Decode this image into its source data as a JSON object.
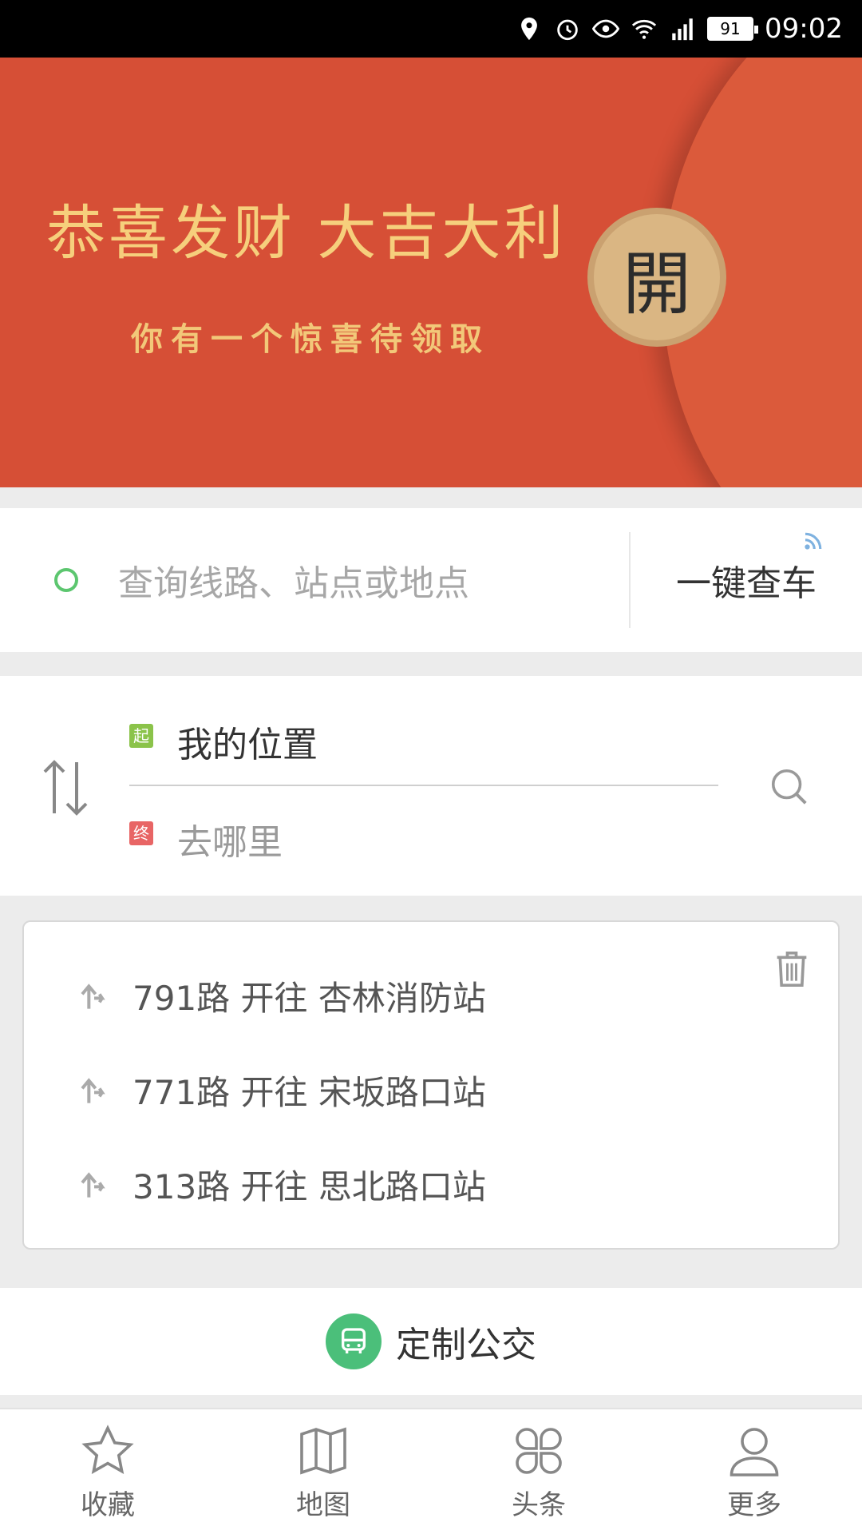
{
  "status": {
    "time": "09:02",
    "battery": "91",
    "network": "4G"
  },
  "banner": {
    "title": "恭喜发财 大吉大利",
    "subtitle": "你有一个惊喜待领取",
    "coin": "開"
  },
  "search": {
    "placeholder": "查询线路、站点或地点",
    "quick_check": "一键查车"
  },
  "route": {
    "start_tag": "起",
    "end_tag": "终",
    "from": "我的位置",
    "to_placeholder": "去哪里"
  },
  "history": {
    "items": [
      {
        "route": "791路 开往 杏林消防站"
      },
      {
        "route": "771路 开往 宋坂路口站"
      },
      {
        "route": "313路 开往 思北路口站"
      }
    ]
  },
  "custom_bus": {
    "label": "定制公交"
  },
  "tabs": [
    {
      "label": "收藏",
      "icon": "star-icon"
    },
    {
      "label": "地图",
      "icon": "map-icon"
    },
    {
      "label": "头条",
      "icon": "news-grid-icon"
    },
    {
      "label": "更多",
      "icon": "user-icon"
    }
  ],
  "colors": {
    "banner": "#d64f36",
    "accent_green": "#4bbf7a",
    "gold": "#f6cf7c"
  }
}
